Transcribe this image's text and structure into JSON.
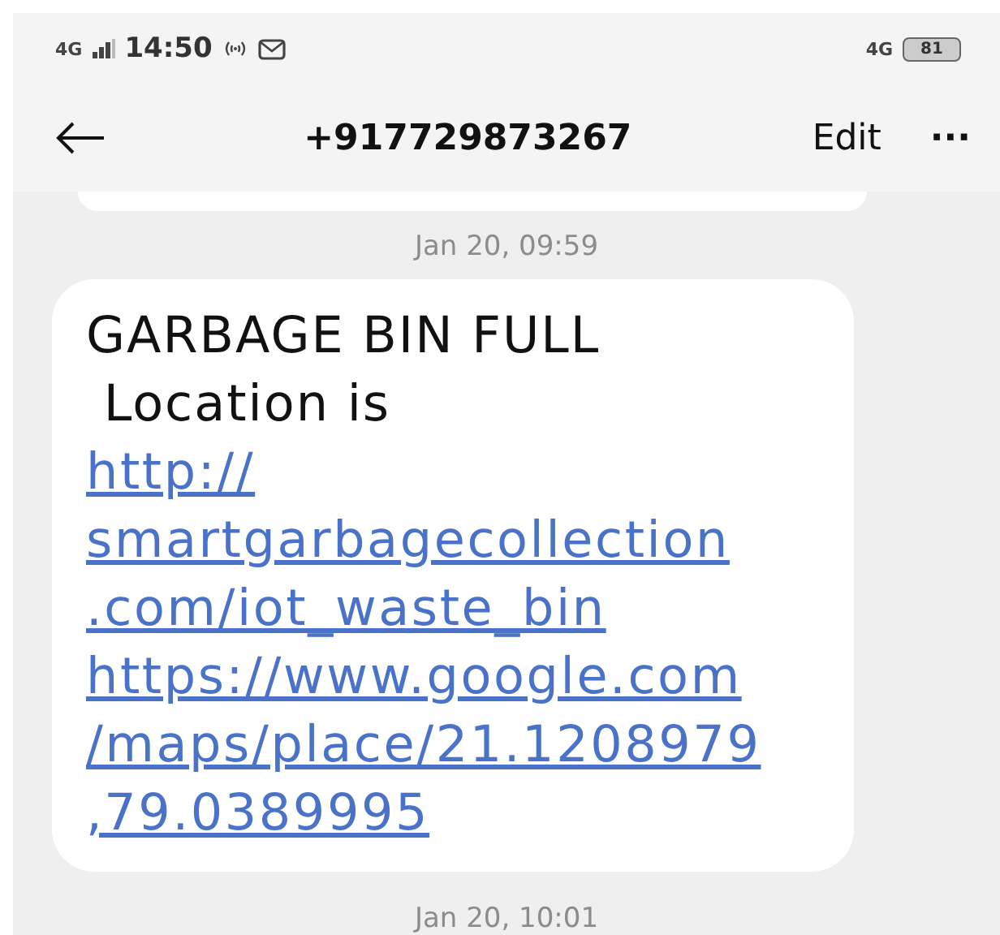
{
  "status_bar": {
    "network": "4G",
    "time": "14:50",
    "data_network": "4G",
    "battery": "81"
  },
  "header": {
    "title": "+917729873267",
    "edit": "Edit",
    "more": "···"
  },
  "messages": [
    {
      "kind": "partial"
    },
    {
      "kind": "date",
      "text": "Jan 20, 09:59"
    },
    {
      "kind": "bubble",
      "lines": [
        {
          "kind": "text",
          "text": "GARBAGE BIN FULL"
        },
        {
          "kind": "text",
          "text": " Location is"
        },
        {
          "kind": "link",
          "text": "http://"
        },
        {
          "kind": "link",
          "text": "smartgarbagecollection"
        },
        {
          "kind": "link",
          "text": ".com/iot_waste_bin"
        },
        {
          "kind": "link",
          "text": "https://www.google.com"
        },
        {
          "kind": "link",
          "text": "/maps/place/21.1208979"
        },
        {
          "kind": "link",
          "text": ",79.0389995"
        }
      ]
    },
    {
      "kind": "date",
      "text": "Jan 20, 10:01"
    }
  ]
}
